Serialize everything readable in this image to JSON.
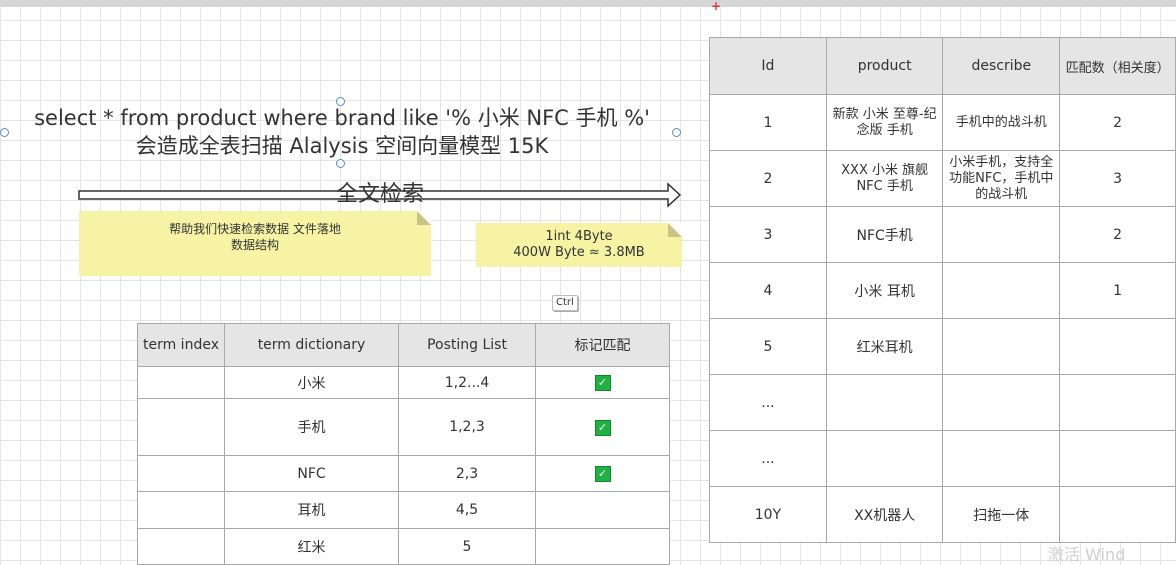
{
  "caption": {
    "line1": "select * from product where brand like '% 小米 NFC 手机 %'",
    "line2": "会造成全表扫描 Alalysis  空间向量模型 15K"
  },
  "arrow_label": "全文检索",
  "note1": {
    "line1": "帮助我们快速检索数据 文件落地",
    "line2": "数据结构"
  },
  "note2": {
    "line1": "1int 4Byte",
    "line2": "400W Byte ≈ 3.8MB"
  },
  "ctrl_key": "Ctrl",
  "term_table": {
    "headers": [
      "term index",
      "term dictionary",
      "Posting List",
      "标记匹配"
    ],
    "rows": [
      {
        "term": "小米",
        "posting": "1,2...4",
        "matched": true
      },
      {
        "term": "手机",
        "posting": "1,2,3",
        "matched": true
      },
      {
        "term": "NFC",
        "posting": "2,3",
        "matched": true
      },
      {
        "term": "耳机",
        "posting": "4,5",
        "matched": false
      },
      {
        "term": "红米",
        "posting": "5",
        "matched": false
      }
    ]
  },
  "product_table": {
    "headers": [
      "Id",
      "product",
      "describe",
      "匹配数（相关度）"
    ],
    "rows": [
      {
        "id": "1",
        "product": "新款 小米 至尊-纪念版 手机",
        "describe": "手机中的战斗机",
        "score": "2"
      },
      {
        "id": "2",
        "product": "XXX 小米 旗舰 NFC 手机",
        "describe": "小米手机，支持全功能NFC，手机中的战斗机",
        "score": "3"
      },
      {
        "id": "3",
        "product": "NFC手机",
        "describe": "",
        "score": "2"
      },
      {
        "id": "4",
        "product": "小米 耳机",
        "describe": "",
        "score": "1"
      },
      {
        "id": "5",
        "product": "红米耳机",
        "describe": "",
        "score": ""
      },
      {
        "id": "...",
        "product": "",
        "describe": "",
        "score": ""
      },
      {
        "id": "...",
        "product": "",
        "describe": "",
        "score": ""
      },
      {
        "id": "10Y",
        "product": "XX机器人",
        "describe": "扫拖一体",
        "score": ""
      }
    ]
  },
  "watermark": "激活 Wind"
}
